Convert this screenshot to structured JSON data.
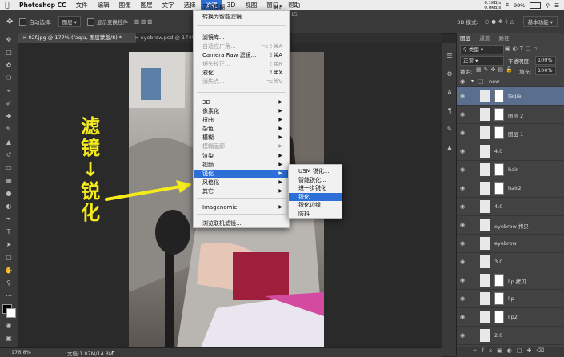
{
  "menubar": {
    "app_name": "Photoshop CC",
    "items": [
      "文件",
      "编辑",
      "图像",
      "图层",
      "文字",
      "选择",
      "滤镜",
      "3D",
      "视图",
      "窗口",
      "帮助"
    ],
    "active_index": 6,
    "window_title": "p CC 2015",
    "net_up": "0.1KB/s",
    "net_down": "0.0KB/s",
    "battery": "99%"
  },
  "options_bar": {
    "auto_select_label": "自动选择:",
    "auto_select_value": "图层",
    "show_transform_label": "显示变换控件",
    "mode_3d_label": "3D 模式:",
    "workspace": "基本功能"
  },
  "doc_tabs": [
    {
      "label": "02f.jpg @ 177% (faqia, 图层蒙版/8) *"
    },
    {
      "label": "eyebrow.psd @ 174%"
    }
  ],
  "status": {
    "zoom": "176.8%",
    "doc_size": "文档:1.07M/14.8M"
  },
  "filter_menu": {
    "items": [
      {
        "label": "高斯模糊",
        "shortcut": "⌘F",
        "dim": false
      },
      {
        "label": "转换为智能滤镜",
        "shortcut": "",
        "dim": false
      },
      {
        "label": "滤镜库...",
        "shortcut": "",
        "dim": false
      },
      {
        "label": "自适应广角...",
        "shortcut": "⌥⇧⌘A",
        "dim": true
      },
      {
        "label": "Camera Raw 滤镜...",
        "shortcut": "⇧⌘A",
        "dim": false
      },
      {
        "label": "镜头校正...",
        "shortcut": "⇧⌘R",
        "dim": true
      },
      {
        "label": "液化...",
        "shortcut": "⇧⌘X",
        "dim": false
      },
      {
        "label": "消失点...",
        "shortcut": "⌥⌘V",
        "dim": true
      },
      {
        "label": "3D",
        "shortcut": "",
        "dim": false,
        "sub": true
      },
      {
        "label": "像素化",
        "shortcut": "",
        "dim": false,
        "sub": true
      },
      {
        "label": "扭曲",
        "shortcut": "",
        "dim": false,
        "sub": true
      },
      {
        "label": "杂色",
        "shortcut": "",
        "dim": false,
        "sub": true
      },
      {
        "label": "模糊",
        "shortcut": "",
        "dim": false,
        "sub": true
      },
      {
        "label": "模糊画廊",
        "shortcut": "",
        "dim": true,
        "sub": true
      },
      {
        "label": "渲染",
        "shortcut": "",
        "dim": false,
        "sub": true
      },
      {
        "label": "视频",
        "shortcut": "",
        "dim": false,
        "sub": true
      },
      {
        "label": "锐化",
        "shortcut": "",
        "dim": false,
        "sub": true,
        "hl": true
      },
      {
        "label": "风格化",
        "shortcut": "",
        "dim": false,
        "sub": true
      },
      {
        "label": "其它",
        "shortcut": "",
        "dim": false,
        "sub": true
      },
      {
        "label": "Imagenomic",
        "shortcut": "",
        "dim": false,
        "sub": true
      },
      {
        "label": "浏览联机滤镜...",
        "shortcut": "",
        "dim": false
      }
    ]
  },
  "sharpen_submenu": {
    "items": [
      {
        "label": "USM 锐化...",
        "hl": false
      },
      {
        "label": "智能锐化...",
        "hl": false
      },
      {
        "label": "进一步锐化",
        "hl": false
      },
      {
        "label": "锐化",
        "hl": true
      },
      {
        "label": "锐化边缘",
        "hl": false
      },
      {
        "label": "防抖...",
        "hl": false
      }
    ]
  },
  "annotation": {
    "line1": "滤",
    "line2": "镜",
    "arrow": "↓",
    "line3": "锐",
    "line4": "化",
    "color": "#f4ea1c"
  },
  "layers_panel": {
    "tabs": [
      "图层",
      "通道",
      "路径"
    ],
    "kind_label": "类型",
    "blend_mode": "正常",
    "opacity_label": "不透明度:",
    "opacity_value": "100%",
    "lock_label": "锁定:",
    "fill_label": "填充:",
    "fill_value": "100%",
    "group_name": "new",
    "layers": [
      {
        "name": "faqia",
        "mask": true,
        "selected": true
      },
      {
        "name": "图层 2",
        "mask": true,
        "selected": false
      },
      {
        "name": "图层 1",
        "mask": true,
        "selected": false
      },
      {
        "name": "4.0",
        "mask": false,
        "selected": false
      },
      {
        "name": "hair",
        "mask": true,
        "selected": false
      },
      {
        "name": "hair2",
        "mask": true,
        "selected": false
      },
      {
        "name": "4.0",
        "mask": false,
        "selected": false
      },
      {
        "name": "eyebrow 拷贝",
        "mask": false,
        "selected": false
      },
      {
        "name": "eyebrow",
        "mask": false,
        "selected": false
      },
      {
        "name": "3.0",
        "mask": false,
        "selected": false
      },
      {
        "name": "lip 拷贝",
        "mask": true,
        "selected": false
      },
      {
        "name": "lip",
        "mask": true,
        "selected": false
      },
      {
        "name": "lip2",
        "mask": true,
        "selected": false
      },
      {
        "name": "2.0",
        "mask": false,
        "selected": false
      }
    ]
  },
  "colors": {
    "menu_highlight": "#2c6fd6",
    "selected_layer": "#5a6f8e"
  }
}
